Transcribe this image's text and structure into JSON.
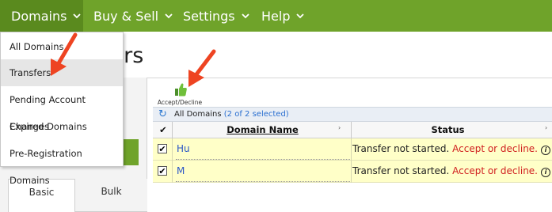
{
  "nav": {
    "items": [
      {
        "label": "Domains"
      },
      {
        "label": "Buy & Sell"
      },
      {
        "label": "Settings"
      },
      {
        "label": "Help"
      }
    ]
  },
  "page_title": "fers",
  "dropdown": {
    "items": [
      {
        "label": "All Domains"
      },
      {
        "label": "Transfers"
      },
      {
        "label": "Pending Account Changes"
      },
      {
        "label": "Expired Domains"
      },
      {
        "label": "Pre-Registration Domains"
      }
    ]
  },
  "search_tabs": {
    "basic": "Basic",
    "bulk": "Bulk"
  },
  "toolbar": {
    "accept_label": "Accept/Decline"
  },
  "grid": {
    "title": "All Domains",
    "selection": "(2 of 2 selected)",
    "columns": {
      "domain": "Domain Name",
      "status": "Status"
    },
    "rows": [
      {
        "domain": "Hu",
        "status_text": "Transfer not started.",
        "status_link": "Accept or decline."
      },
      {
        "domain": "M",
        "status_text": "Transfer not started.",
        "status_link": "Accept or decline."
      }
    ]
  },
  "colors": {
    "nav_green": "#6fa32a",
    "row_highlight": "#ffffc8",
    "annotation_arrow": "#ee4422"
  }
}
